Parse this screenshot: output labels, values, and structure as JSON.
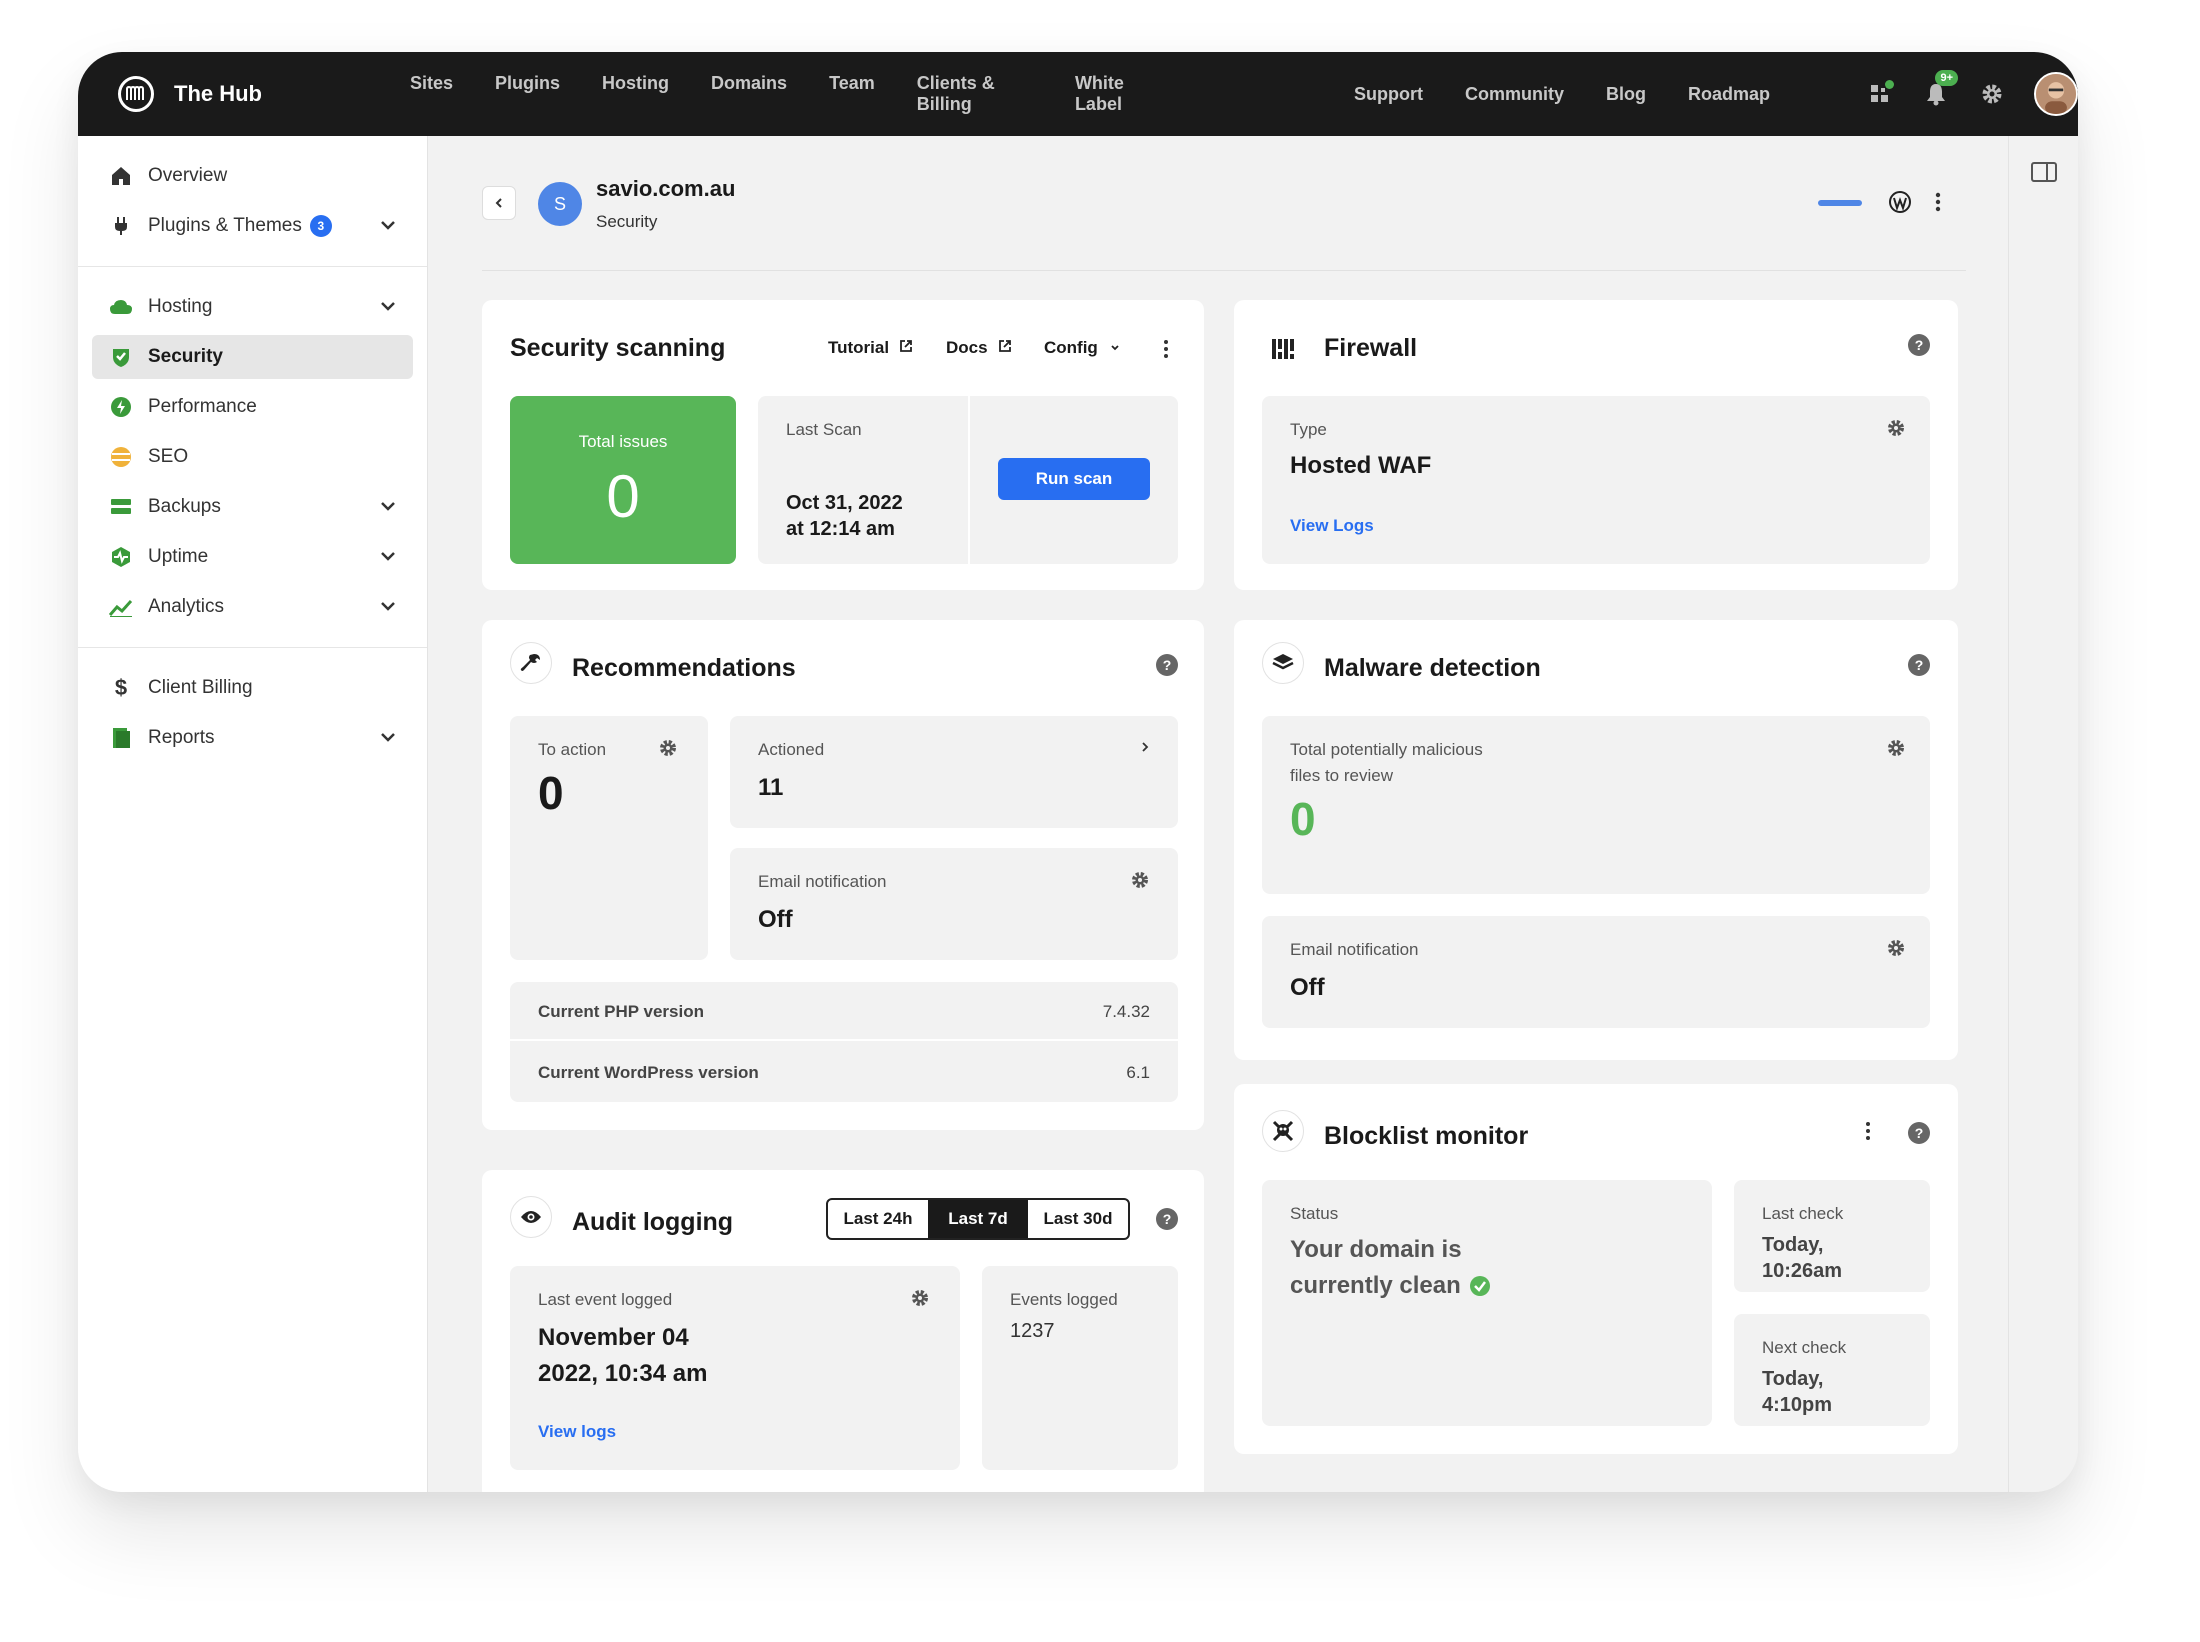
{
  "topbar": {
    "brand": "The Hub",
    "nav_left": [
      "Sites",
      "Plugins",
      "Hosting",
      "Domains",
      "Team",
      "Clients & Billing",
      "White Label"
    ],
    "nav_right": [
      "Support",
      "Community",
      "Blog",
      "Roadmap"
    ],
    "notification_badge": "9+"
  },
  "sidebar": {
    "group1": [
      {
        "label": "Overview",
        "icon": "home-icon"
      },
      {
        "label": "Plugins & Themes",
        "icon": "plug-icon",
        "badge": "3"
      }
    ],
    "group2": [
      {
        "label": "Hosting",
        "icon": "cloud-icon"
      },
      {
        "label": "Security",
        "icon": "shield-icon"
      },
      {
        "label": "Performance",
        "icon": "bolt-icon"
      },
      {
        "label": "SEO",
        "icon": "seo-icon"
      },
      {
        "label": "Backups",
        "icon": "database-icon"
      },
      {
        "label": "Uptime",
        "icon": "heartbeat-icon"
      },
      {
        "label": "Analytics",
        "icon": "chart-icon"
      }
    ],
    "group3": [
      {
        "label": "Client Billing",
        "icon": "dollar-icon"
      },
      {
        "label": "Reports",
        "icon": "report-icon"
      }
    ]
  },
  "header": {
    "site_initial": "S",
    "site_name": "savio.com.au",
    "section": "Security"
  },
  "scanning": {
    "title": "Security scanning",
    "tutorial": "Tutorial",
    "docs": "Docs",
    "config": "Config",
    "total_issues_label": "Total issues",
    "total_issues_value": "0",
    "last_scan_label": "Last Scan",
    "last_scan_date": "Oct 31, 2022",
    "last_scan_time": "at 12:14 am",
    "run_scan": "Run scan"
  },
  "firewall": {
    "title": "Firewall",
    "type_label": "Type",
    "type_value": "Hosted WAF",
    "view_logs": "View Logs"
  },
  "recommendations": {
    "title": "Recommendations",
    "to_action_label": "To action",
    "to_action_value": "0",
    "actioned_label": "Actioned",
    "actioned_value": "11",
    "email_label": "Email notification",
    "email_value": "Off",
    "php_label": "Current PHP version",
    "php_value": "7.4.32",
    "wp_label": "Current WordPress version",
    "wp_value": "6.1"
  },
  "malware": {
    "title": "Malware detection",
    "files_label_1": "Total potentially malicious",
    "files_label_2": "files to review",
    "files_value": "0",
    "email_label": "Email notification",
    "email_value": "Off"
  },
  "audit": {
    "title": "Audit logging",
    "ranges": [
      "Last 24h",
      "Last 7d",
      "Last 30d"
    ],
    "active_range": "Last 7d",
    "last_event_label": "Last event logged",
    "last_event_line1": "November 04",
    "last_event_line2": "2022, 10:34 am",
    "view_logs": "View logs",
    "events_label": "Events logged",
    "events_value": "1237"
  },
  "blocklist": {
    "title": "Blocklist monitor",
    "status_label": "Status",
    "status_line1": "Your domain is",
    "status_line2": "currently clean",
    "last_check_label": "Last check",
    "last_check_line1": "Today,",
    "last_check_line2": "10:26am",
    "next_check_label": "Next check",
    "next_check_line1": "Today,",
    "next_check_line2": "4:10pm"
  },
  "colors": {
    "accent_blue": "#286ef1",
    "success_green": "#58b658",
    "topbar_bg": "#1a1a1a"
  }
}
